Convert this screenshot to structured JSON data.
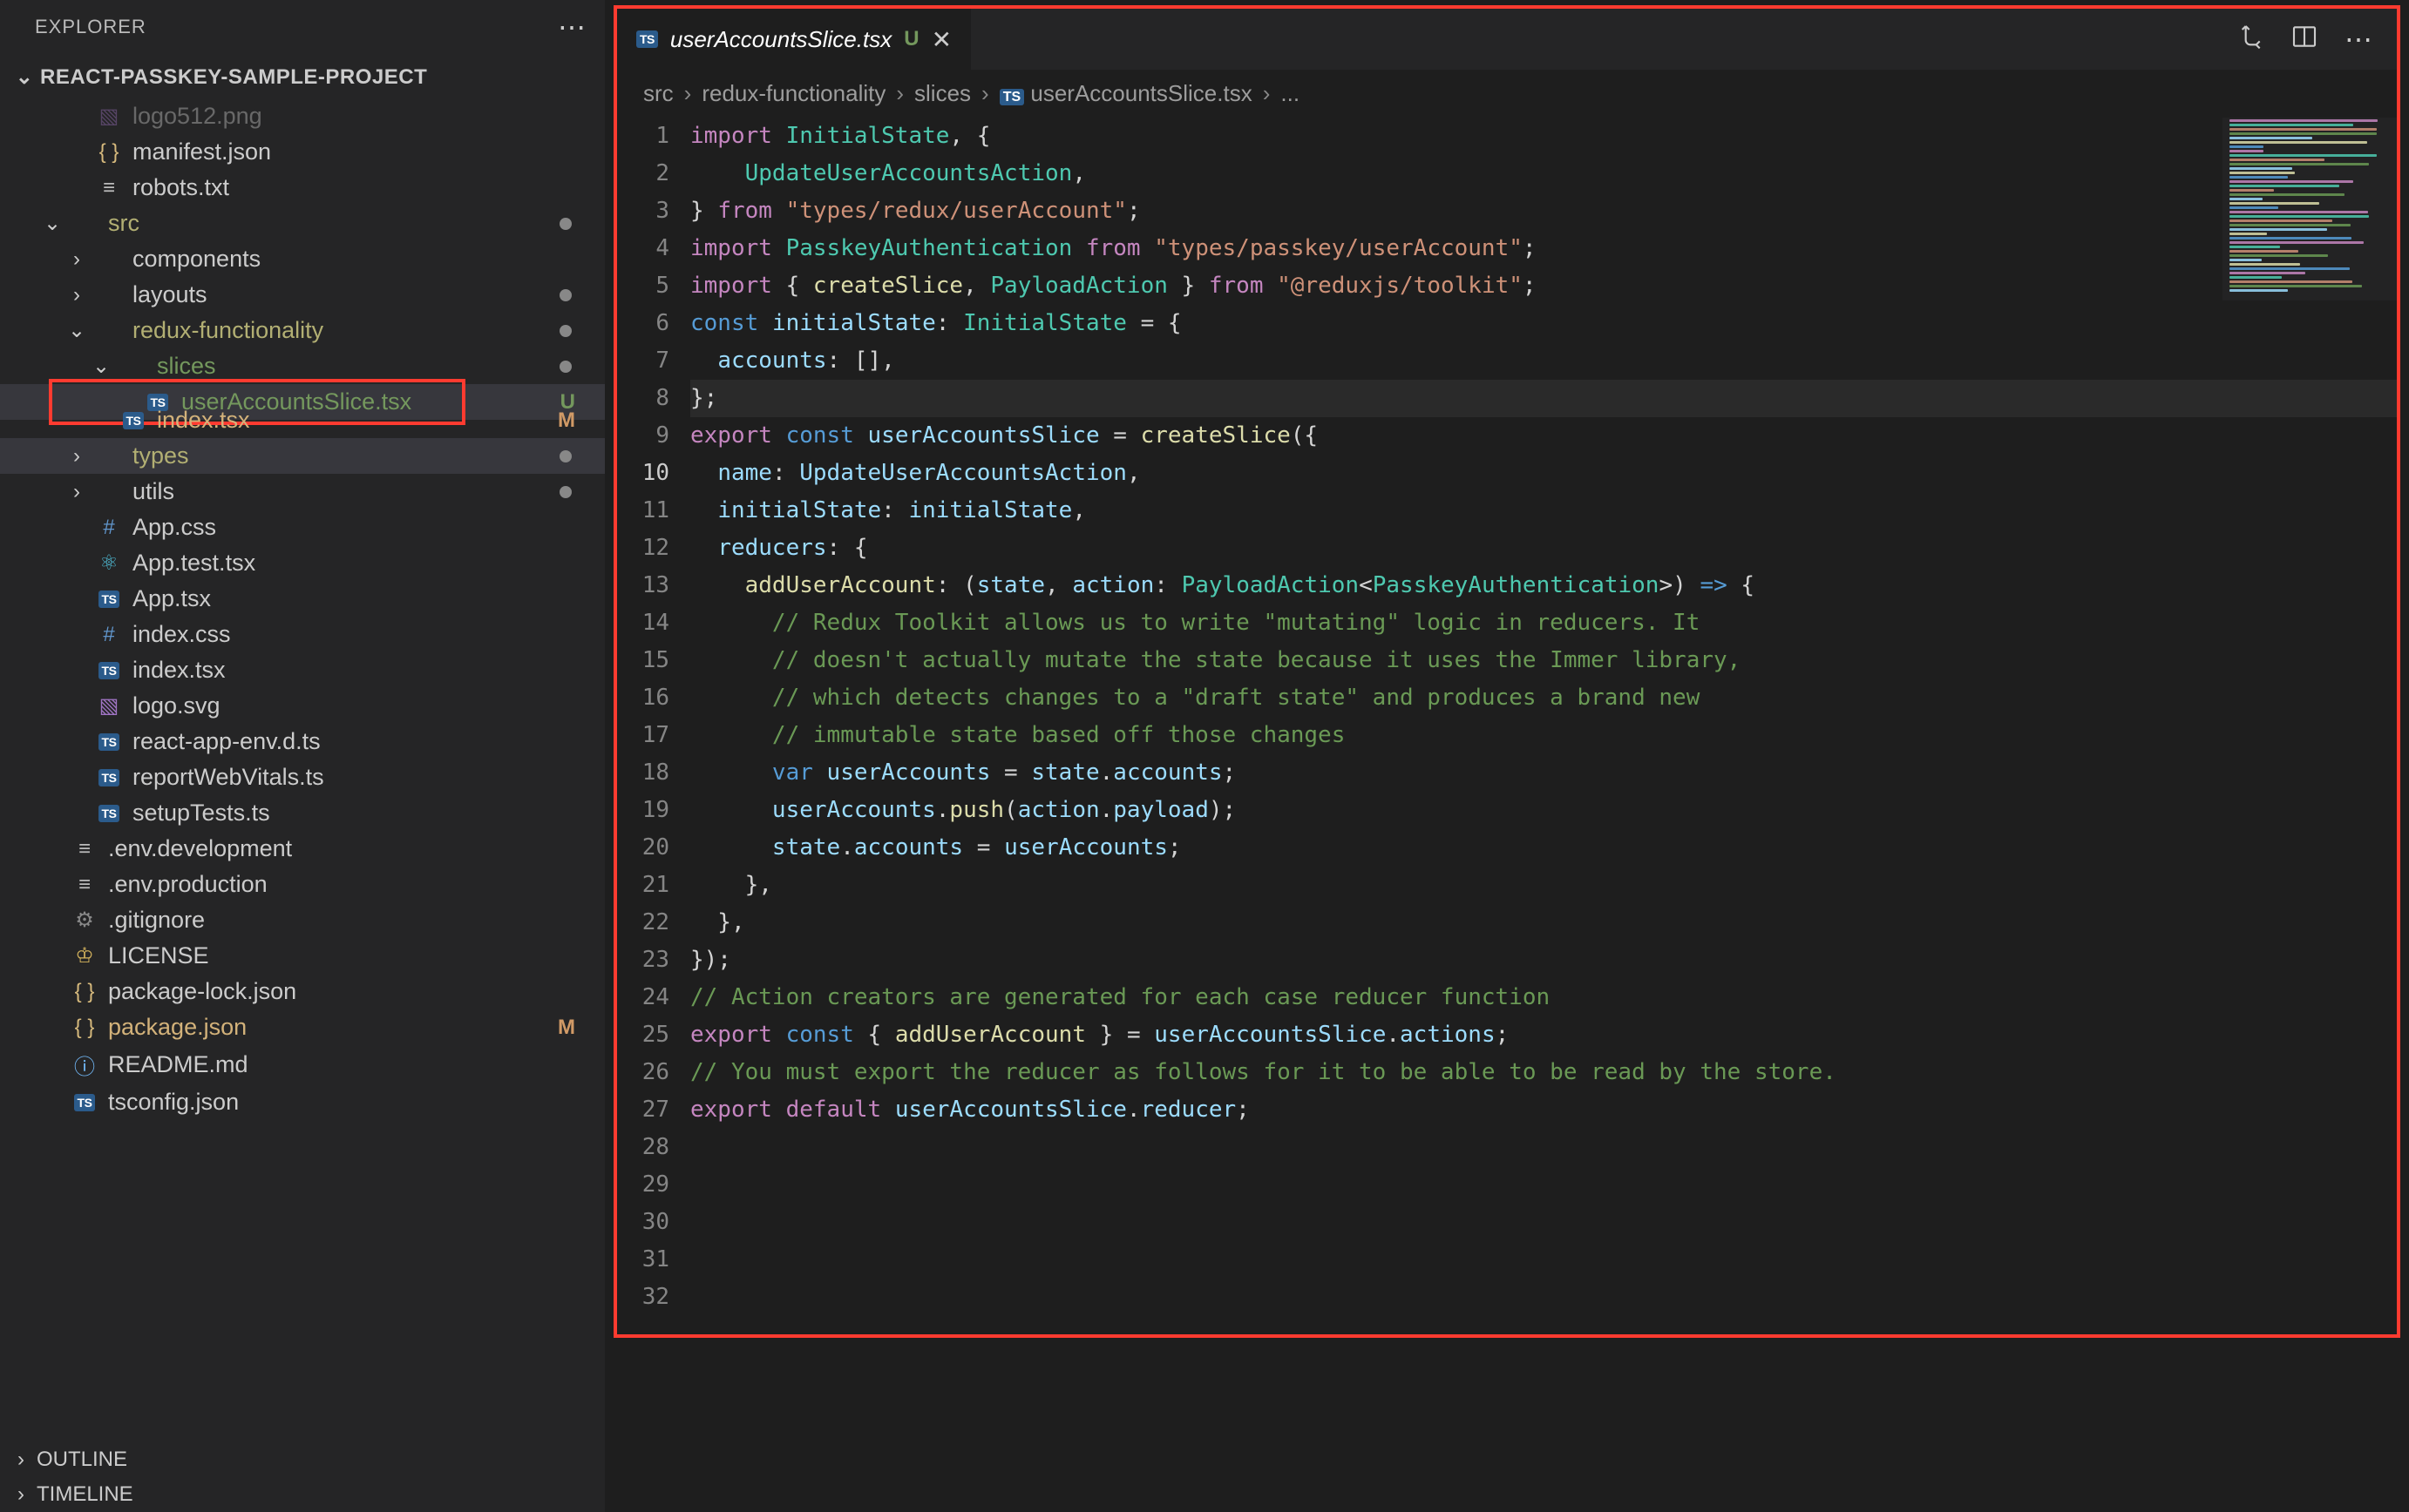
{
  "sidebar": {
    "title": "EXPLORER",
    "project": "REACT-PASSKEY-SAMPLE-PROJECT",
    "outline": "OUTLINE",
    "timeline": "TIMELINE",
    "items": [
      {
        "icon": "img",
        "label": "logo512.png",
        "indent": 2,
        "chevron": "",
        "cutoff": true
      },
      {
        "icon": "json",
        "label": "manifest.json",
        "indent": 2,
        "chevron": ""
      },
      {
        "icon": "lines",
        "label": "robots.txt",
        "indent": 2,
        "chevron": ""
      },
      {
        "icon": "",
        "label": "src",
        "indent": 1,
        "chevron": "down",
        "class": "olive",
        "dot": true
      },
      {
        "icon": "",
        "label": "components",
        "indent": 2,
        "chevron": "right"
      },
      {
        "icon": "",
        "label": "layouts",
        "indent": 2,
        "chevron": "right",
        "dot": true
      },
      {
        "icon": "",
        "label": "redux-functionality",
        "indent": 2,
        "chevron": "down",
        "class": "olive",
        "dot": true
      },
      {
        "icon": "",
        "label": "slices",
        "indent": 3,
        "chevron": "down",
        "class": "green-text",
        "dot": true
      },
      {
        "icon": "ts",
        "label": "userAccountsSlice.tsx",
        "indent": 4,
        "chevron": "",
        "class": "green-text",
        "badge": "U",
        "highlighted": true,
        "redbox": true
      },
      {
        "icon": "ts",
        "label": "index.tsx",
        "indent": 3,
        "chevron": "",
        "class": "modified-text",
        "badge": "M",
        "badgeClass": "m",
        "halfcut": true
      },
      {
        "icon": "",
        "label": "types",
        "indent": 2,
        "chevron": "right",
        "class": "olive",
        "dot": true,
        "highlighted": true
      },
      {
        "icon": "",
        "label": "utils",
        "indent": 2,
        "chevron": "right",
        "dot": true
      },
      {
        "icon": "hash",
        "label": "App.css",
        "indent": 2,
        "chevron": ""
      },
      {
        "icon": "react",
        "label": "App.test.tsx",
        "indent": 2,
        "chevron": ""
      },
      {
        "icon": "ts",
        "label": "App.tsx",
        "indent": 2,
        "chevron": ""
      },
      {
        "icon": "hash",
        "label": "index.css",
        "indent": 2,
        "chevron": ""
      },
      {
        "icon": "ts",
        "label": "index.tsx",
        "indent": 2,
        "chevron": ""
      },
      {
        "icon": "img",
        "label": "logo.svg",
        "indent": 2,
        "chevron": ""
      },
      {
        "icon": "ts",
        "label": "react-app-env.d.ts",
        "indent": 2,
        "chevron": ""
      },
      {
        "icon": "ts",
        "label": "reportWebVitals.ts",
        "indent": 2,
        "chevron": ""
      },
      {
        "icon": "ts",
        "label": "setupTests.ts",
        "indent": 2,
        "chevron": ""
      },
      {
        "icon": "lines",
        "label": ".env.development",
        "indent": 1,
        "chevron": ""
      },
      {
        "icon": "lines",
        "label": ".env.production",
        "indent": 1,
        "chevron": ""
      },
      {
        "icon": "gear",
        "label": ".gitignore",
        "indent": 1,
        "chevron": ""
      },
      {
        "icon": "license",
        "label": "LICENSE",
        "indent": 1,
        "chevron": ""
      },
      {
        "icon": "json",
        "label": "package-lock.json",
        "indent": 1,
        "chevron": ""
      },
      {
        "icon": "json",
        "label": "package.json",
        "indent": 1,
        "chevron": "",
        "class": "modified-text",
        "badge": "M",
        "badgeClass": "m"
      },
      {
        "icon": "info",
        "label": "README.md",
        "indent": 1,
        "chevron": ""
      },
      {
        "icon": "ts",
        "label": "tsconfig.json",
        "indent": 1,
        "chevron": ""
      }
    ]
  },
  "tab": {
    "icon": "TS",
    "label": "userAccountsSlice.tsx",
    "status": "U"
  },
  "breadcrumbs": [
    "src",
    "redux-functionality",
    "slices",
    "userAccountsSlice.tsx",
    "..."
  ],
  "code_lines": [
    [
      [
        "kw",
        "import"
      ],
      [
        "punct",
        " "
      ],
      [
        "type",
        "InitialState"
      ],
      [
        "punct",
        ", {"
      ]
    ],
    [
      [
        "punct",
        "    "
      ],
      [
        "type",
        "UpdateUserAccountsAction"
      ],
      [
        "punct",
        ","
      ]
    ],
    [
      [
        "punct",
        "} "
      ],
      [
        "kw",
        "from"
      ],
      [
        "punct",
        " "
      ],
      [
        "str",
        "\"types/redux/userAccount\""
      ],
      [
        "punct",
        ";"
      ]
    ],
    [
      [
        "kw",
        "import"
      ],
      [
        "punct",
        " "
      ],
      [
        "type",
        "PasskeyAuthentication"
      ],
      [
        "punct",
        " "
      ],
      [
        "kw",
        "from"
      ],
      [
        "punct",
        " "
      ],
      [
        "str",
        "\"types/passkey/userAccount\""
      ],
      [
        "punct",
        ";"
      ]
    ],
    [
      [
        "punct",
        ""
      ]
    ],
    [
      [
        "kw",
        "import"
      ],
      [
        "punct",
        " { "
      ],
      [
        "fn",
        "createSlice"
      ],
      [
        "punct",
        ", "
      ],
      [
        "type",
        "PayloadAction"
      ],
      [
        "punct",
        " } "
      ],
      [
        "kw",
        "from"
      ],
      [
        "punct",
        " "
      ],
      [
        "str",
        "\"@reduxjs/toolkit\""
      ],
      [
        "punct",
        ";"
      ]
    ],
    [
      [
        "punct",
        ""
      ]
    ],
    [
      [
        "const-kw",
        "const"
      ],
      [
        "punct",
        " "
      ],
      [
        "var",
        "initialState"
      ],
      [
        "punct",
        ": "
      ],
      [
        "type",
        "InitialState"
      ],
      [
        "punct",
        " = {"
      ]
    ],
    [
      [
        "punct",
        "  "
      ],
      [
        "prop",
        "accounts"
      ],
      [
        "punct",
        ": [],"
      ]
    ],
    [
      [
        "punct",
        "};"
      ]
    ],
    [
      [
        "punct",
        ""
      ]
    ],
    [
      [
        "kw",
        "export"
      ],
      [
        "punct",
        " "
      ],
      [
        "const-kw",
        "const"
      ],
      [
        "punct",
        " "
      ],
      [
        "var",
        "userAccountsSlice"
      ],
      [
        "punct",
        " = "
      ],
      [
        "fn",
        "createSlice"
      ],
      [
        "punct",
        "({"
      ]
    ],
    [
      [
        "punct",
        "  "
      ],
      [
        "prop",
        "name"
      ],
      [
        "punct",
        ": "
      ],
      [
        "var",
        "UpdateUserAccountsAction"
      ],
      [
        "punct",
        ","
      ]
    ],
    [
      [
        "punct",
        "  "
      ],
      [
        "prop",
        "initialState"
      ],
      [
        "punct",
        ": "
      ],
      [
        "var",
        "initialState"
      ],
      [
        "punct",
        ","
      ]
    ],
    [
      [
        "punct",
        "  "
      ],
      [
        "prop",
        "reducers"
      ],
      [
        "punct",
        ": {"
      ]
    ],
    [
      [
        "punct",
        "    "
      ],
      [
        "fn",
        "addUserAccount"
      ],
      [
        "punct",
        ": ("
      ],
      [
        "var",
        "state"
      ],
      [
        "punct",
        ", "
      ],
      [
        "var",
        "action"
      ],
      [
        "punct",
        ": "
      ],
      [
        "type",
        "PayloadAction"
      ],
      [
        "punct",
        "<"
      ],
      [
        "type",
        "PasskeyAuthentication"
      ],
      [
        "punct",
        ">) "
      ],
      [
        "const-kw",
        "=>"
      ],
      [
        "punct",
        " {"
      ]
    ],
    [
      [
        "punct",
        "      "
      ],
      [
        "cmt",
        "// Redux Toolkit allows us to write \"mutating\" logic in reducers. It"
      ]
    ],
    [
      [
        "punct",
        "      "
      ],
      [
        "cmt",
        "// doesn't actually mutate the state because it uses the Immer library,"
      ]
    ],
    [
      [
        "punct",
        "      "
      ],
      [
        "cmt",
        "// which detects changes to a \"draft state\" and produces a brand new"
      ]
    ],
    [
      [
        "punct",
        "      "
      ],
      [
        "cmt",
        "// immutable state based off those changes"
      ]
    ],
    [
      [
        "punct",
        "      "
      ],
      [
        "const-kw",
        "var"
      ],
      [
        "punct",
        " "
      ],
      [
        "var",
        "userAccounts"
      ],
      [
        "punct",
        " = "
      ],
      [
        "var",
        "state"
      ],
      [
        "punct",
        "."
      ],
      [
        "prop",
        "accounts"
      ],
      [
        "punct",
        ";"
      ]
    ],
    [
      [
        "punct",
        "      "
      ],
      [
        "var",
        "userAccounts"
      ],
      [
        "punct",
        "."
      ],
      [
        "fn",
        "push"
      ],
      [
        "punct",
        "("
      ],
      [
        "var",
        "action"
      ],
      [
        "punct",
        "."
      ],
      [
        "prop",
        "payload"
      ],
      [
        "punct",
        ");"
      ]
    ],
    [
      [
        "punct",
        "      "
      ],
      [
        "var",
        "state"
      ],
      [
        "punct",
        "."
      ],
      [
        "prop",
        "accounts"
      ],
      [
        "punct",
        " = "
      ],
      [
        "var",
        "userAccounts"
      ],
      [
        "punct",
        ";"
      ]
    ],
    [
      [
        "punct",
        "    },"
      ]
    ],
    [
      [
        "punct",
        "  },"
      ]
    ],
    [
      [
        "punct",
        "});"
      ]
    ],
    [
      [
        "punct",
        ""
      ]
    ],
    [
      [
        "cmt",
        "// Action creators are generated for each case reducer function"
      ]
    ],
    [
      [
        "kw",
        "export"
      ],
      [
        "punct",
        " "
      ],
      [
        "const-kw",
        "const"
      ],
      [
        "punct",
        " { "
      ],
      [
        "fn",
        "addUserAccount"
      ],
      [
        "punct",
        " } = "
      ],
      [
        "var",
        "userAccountsSlice"
      ],
      [
        "punct",
        "."
      ],
      [
        "prop",
        "actions"
      ],
      [
        "punct",
        ";"
      ]
    ],
    [
      [
        "cmt",
        "// You must export the reducer as follows for it to be able to be read by the store."
      ]
    ],
    [
      [
        "kw",
        "export"
      ],
      [
        "punct",
        " "
      ],
      [
        "kw",
        "default"
      ],
      [
        "punct",
        " "
      ],
      [
        "var",
        "userAccountsSlice"
      ],
      [
        "punct",
        "."
      ],
      [
        "prop",
        "reducer"
      ],
      [
        "punct",
        ";"
      ]
    ],
    [
      [
        "punct",
        ""
      ]
    ]
  ],
  "active_line": 10
}
